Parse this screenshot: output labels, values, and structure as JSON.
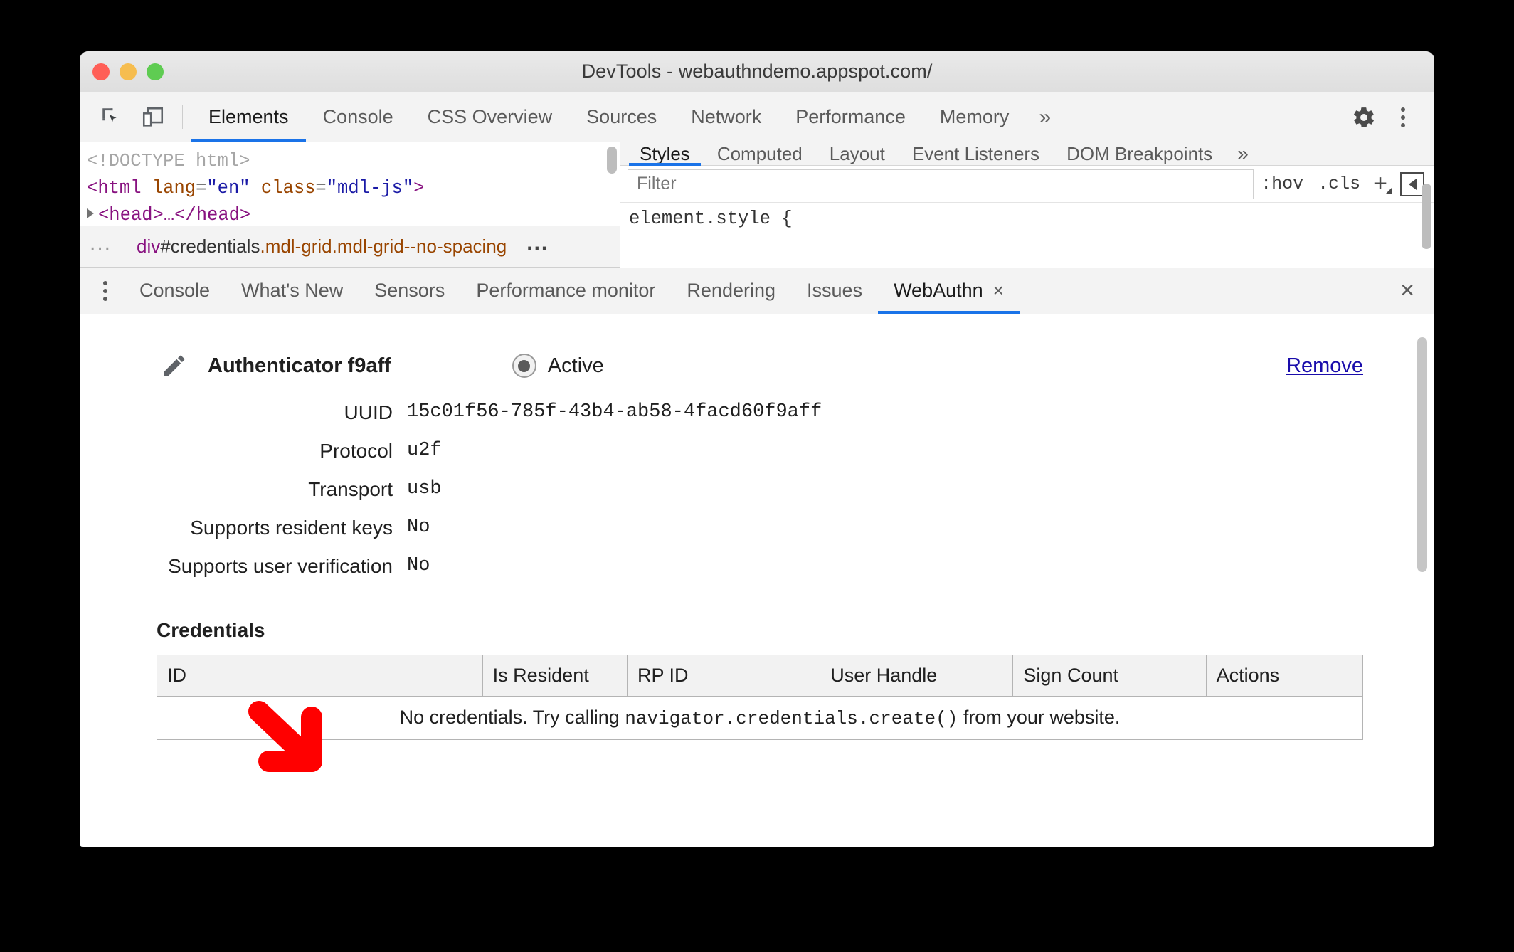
{
  "window": {
    "title": "DevTools - webauthndemo.appspot.com/",
    "traffic_lights": [
      "close",
      "minimize",
      "zoom"
    ]
  },
  "main_toolbar": {
    "icons": [
      "inspect-element-icon",
      "device-toolbar-icon"
    ],
    "tabs": [
      {
        "label": "Elements",
        "active": true
      },
      {
        "label": "Console",
        "active": false
      },
      {
        "label": "CSS Overview",
        "active": false
      },
      {
        "label": "Sources",
        "active": false
      },
      {
        "label": "Network",
        "active": false
      },
      {
        "label": "Performance",
        "active": false
      },
      {
        "label": "Memory",
        "active": false
      }
    ],
    "more_tabs": "»",
    "settings_icon": "gear-icon",
    "menu_icon": "kebab-menu-icon"
  },
  "dom_tree": {
    "lines": [
      {
        "doctype": "<!DOCTYPE html>"
      },
      {
        "open": "<",
        "tag": "html",
        "attr1": "lang",
        "val1": "\"en\"",
        "attr2": "class",
        "val2": "\"mdl-js\"",
        "close": ">"
      },
      {
        "collapsed": "<head>…</head>"
      }
    ]
  },
  "breadcrumb": {
    "left_ellipsis": "...",
    "tag": "div",
    "id": "#credentials",
    "classes": ".mdl-grid.mdl-grid--no-spacing",
    "right_ellipsis": "..."
  },
  "styles_sidebar": {
    "tabs": [
      {
        "label": "Styles",
        "active": true
      },
      {
        "label": "Computed",
        "active": false
      },
      {
        "label": "Layout",
        "active": false
      },
      {
        "label": "Event Listeners",
        "active": false
      },
      {
        "label": "DOM Breakpoints",
        "active": false
      }
    ],
    "more_tabs": "»",
    "filter_placeholder": "Filter",
    "filter_value": "",
    "hov_button": ":hov",
    "cls_button": ".cls",
    "new_rule_button": "+",
    "toggle_sidebar_button": "toggle-sidebar-icon",
    "rule_header": "element.style {"
  },
  "drawer": {
    "menu_icon": "kebab-menu-icon",
    "tabs": [
      {
        "label": "Console",
        "active": false,
        "closable": false
      },
      {
        "label": "What's New",
        "active": false,
        "closable": false
      },
      {
        "label": "Sensors",
        "active": false,
        "closable": false
      },
      {
        "label": "Performance monitor",
        "active": false,
        "closable": false
      },
      {
        "label": "Rendering",
        "active": false,
        "closable": false
      },
      {
        "label": "Issues",
        "active": false,
        "closable": false
      },
      {
        "label": "WebAuthn",
        "active": true,
        "closable": true
      }
    ],
    "tab_close_glyph": "×",
    "drawer_close_glyph": "×"
  },
  "webauthn": {
    "edit_icon": "pencil-icon",
    "authenticator_title": "Authenticator f9aff",
    "state_label": "Active",
    "state_selected": true,
    "remove_label": "Remove",
    "properties": [
      {
        "label": "UUID",
        "value": "15c01f56-785f-43b4-ab58-4facd60f9aff"
      },
      {
        "label": "Protocol",
        "value": "u2f"
      },
      {
        "label": "Transport",
        "value": "usb"
      },
      {
        "label": "Supports resident keys",
        "value": "No"
      },
      {
        "label": "Supports user verification",
        "value": "No"
      }
    ],
    "credentials_title": "Credentials",
    "credentials_columns": [
      "ID",
      "Is Resident",
      "RP ID",
      "User Handle",
      "Sign Count",
      "Actions"
    ],
    "credentials_rows": [],
    "empty_message_prefix": "No credentials. Try calling ",
    "empty_message_code": "navigator.credentials.create()",
    "empty_message_suffix": " from your website."
  },
  "annotation": {
    "arrow": "red-arrow-annotation",
    "color": "#FF0000"
  },
  "colors": {
    "accent": "#1a73e8",
    "link": "#1a0dab",
    "tag": "#881280",
    "attr_name": "#994500",
    "attr_value": "#1a1aa6",
    "traffic_red": "#ff5f57",
    "traffic_yellow": "#f6bd4f",
    "traffic_green": "#5fcc52",
    "arrow_red": "#ff0000"
  }
}
